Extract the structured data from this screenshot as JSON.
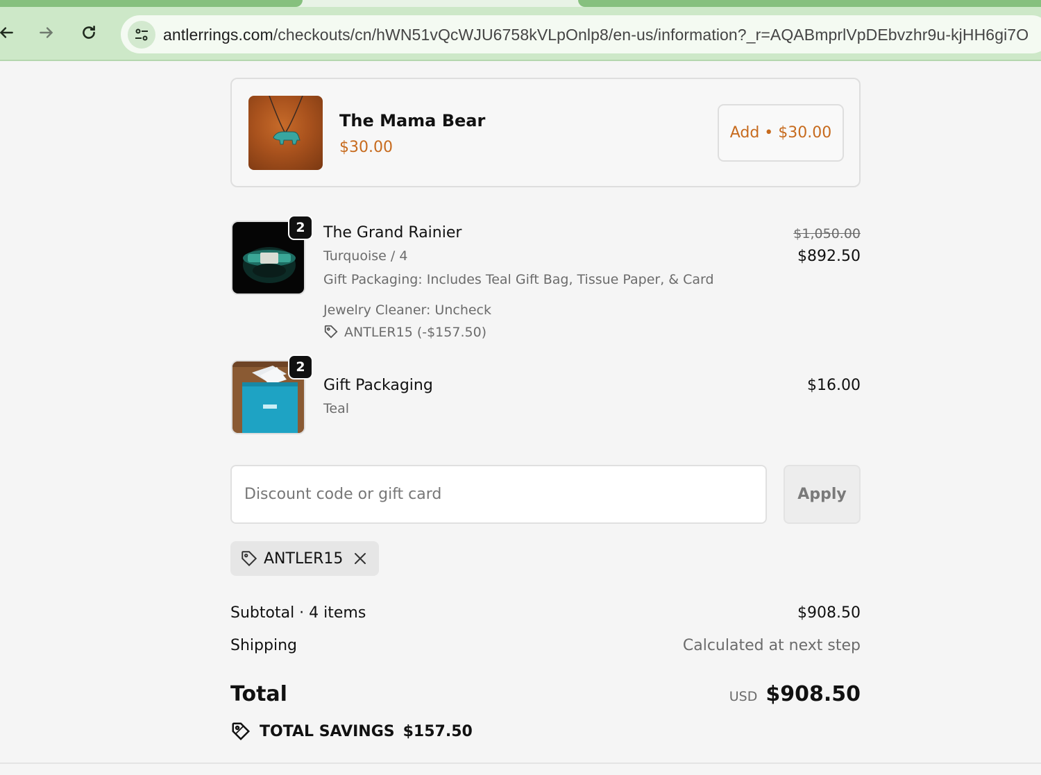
{
  "browser": {
    "url_domain": "antlerrings.com",
    "url_path": "/checkouts/cn/hWN51vQcWJU6758kVLpOnlp8/en-us/information?_r=AQABmprlVpDEbvzhr9u-kjHH6gi7O"
  },
  "upsell": {
    "title": "The Mama Bear",
    "price": "$30.00",
    "add_label": "Add • $30.00",
    "image_icon": "necklace-bear-image"
  },
  "line_items": [
    {
      "name": "The Grand Rainier",
      "quantity": "2",
      "variant": "Turquoise / 4",
      "option_1": "Gift Packaging: Includes Teal Gift Bag, Tissue Paper, & Card",
      "option_2": "Jewelry Cleaner: Uncheck",
      "discount": "ANTLER15 (-$157.50)",
      "compare_price": "$1,050.00",
      "price": "$892.50"
    },
    {
      "name": "Gift Packaging",
      "quantity": "2",
      "variant": "Teal",
      "price": "$16.00"
    }
  ],
  "discount": {
    "placeholder": "Discount code or gift card",
    "apply_label": "Apply",
    "applied_code": "ANTLER15"
  },
  "totals": {
    "subtotal_label": "Subtotal · 4 items",
    "subtotal_value": "$908.50",
    "shipping_label": "Shipping",
    "shipping_value": "Calculated at next step",
    "total_label": "Total",
    "currency": "USD",
    "total_value": "$908.50",
    "savings_label": "TOTAL SAVINGS",
    "savings_value": "$157.50"
  },
  "colors": {
    "accent": "#c76b1e",
    "browser_toolbar": "#cde8c8",
    "tab_active": "#86c07e"
  }
}
